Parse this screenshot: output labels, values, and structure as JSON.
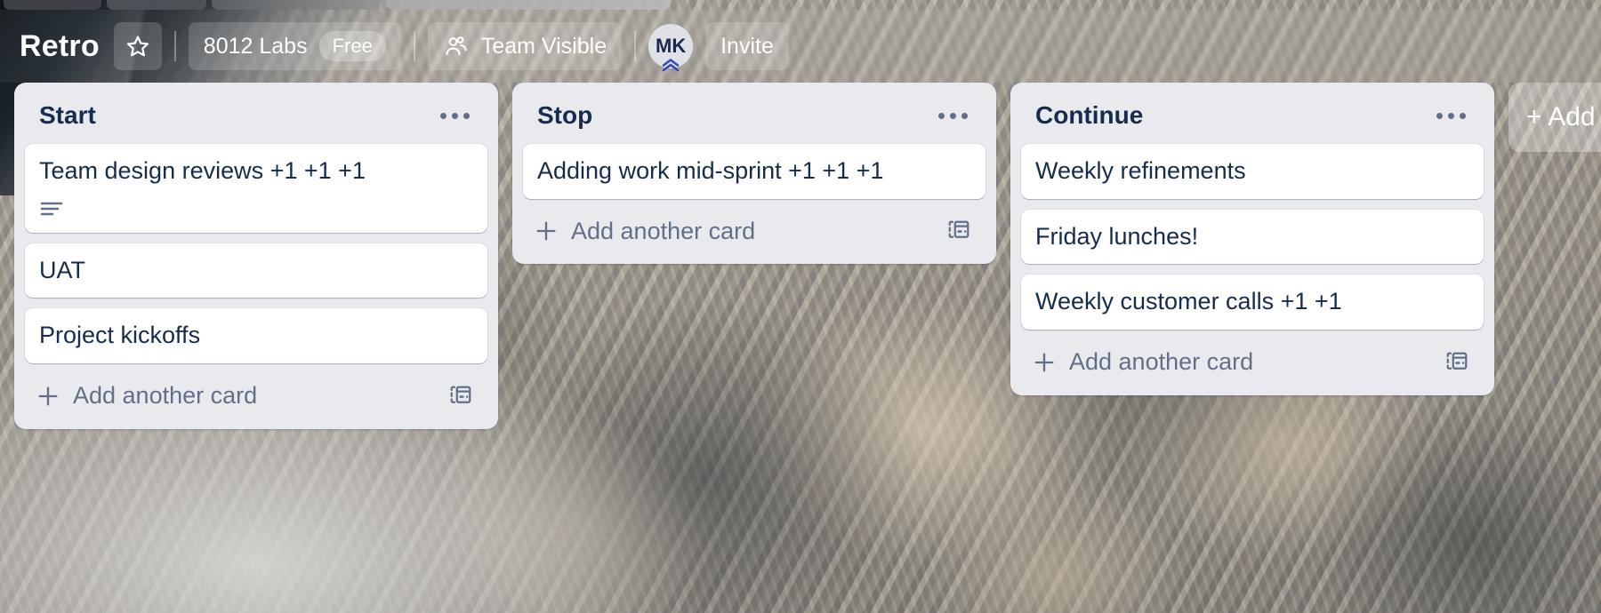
{
  "header": {
    "board_title": "Retro",
    "star_icon": "star-icon",
    "workspace_name": "8012 Labs",
    "plan_badge": "Free",
    "visibility_icon": "people-icon",
    "visibility_label": "Team Visible",
    "avatar_initials": "MK",
    "avatar_badge_icon": "chevron-double-up-icon",
    "invite_label": "Invite"
  },
  "colors": {
    "list_background": "#e9eaee",
    "card_background": "#ffffff",
    "text_primary": "#172b4d",
    "text_subtle": "#626f86",
    "avatar_background": "#dfe1e6",
    "avatar_text": "#182a4e",
    "badge_accent": "#2f4bb3"
  },
  "board": {
    "add_list_label": "+ Add",
    "lists": [
      {
        "title": "Start",
        "menu_icon": "ellipsis-icon",
        "add_card_label": "Add another card",
        "add_card_icon": "plus-icon",
        "template_icon": "card-template-icon",
        "cards": [
          {
            "title": "Team design reviews +1 +1 +1",
            "has_description": true,
            "description_icon": "description-icon"
          },
          {
            "title": "UAT",
            "has_description": false
          },
          {
            "title": "Project kickoffs",
            "has_description": false
          }
        ]
      },
      {
        "title": "Stop",
        "menu_icon": "ellipsis-icon",
        "add_card_label": "Add another card",
        "add_card_icon": "plus-icon",
        "template_icon": "card-template-icon",
        "cards": [
          {
            "title": "Adding work mid-sprint +1 +1 +1",
            "has_description": false
          }
        ]
      },
      {
        "title": "Continue",
        "menu_icon": "ellipsis-icon",
        "add_card_label": "Add another card",
        "add_card_icon": "plus-icon",
        "template_icon": "card-template-icon",
        "cards": [
          {
            "title": "Weekly refinements",
            "has_description": false
          },
          {
            "title": "Friday lunches!",
            "has_description": false
          },
          {
            "title": "Weekly customer calls +1 +1",
            "has_description": false
          }
        ]
      }
    ]
  }
}
